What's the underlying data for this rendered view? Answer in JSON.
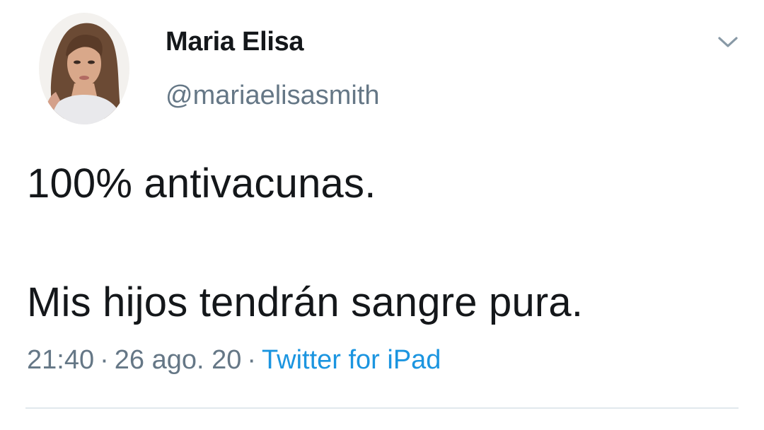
{
  "user": {
    "display_name": "Maria Elisa",
    "handle": "@mariaelisasmith"
  },
  "tweet": {
    "line1": "100% antivacunas.",
    "line2": "Mis hijos tendrán sangre pura.",
    "time": "21:40",
    "date": "26 ago. 20",
    "separator": "·",
    "source": "Twitter for iPad"
  },
  "colors": {
    "text": "#14171a",
    "secondary": "#657786",
    "link": "#1b95e0",
    "divider": "#e1e8ed"
  },
  "icons": {
    "menu": "chevron-down-icon",
    "avatar": "profile-photo"
  }
}
